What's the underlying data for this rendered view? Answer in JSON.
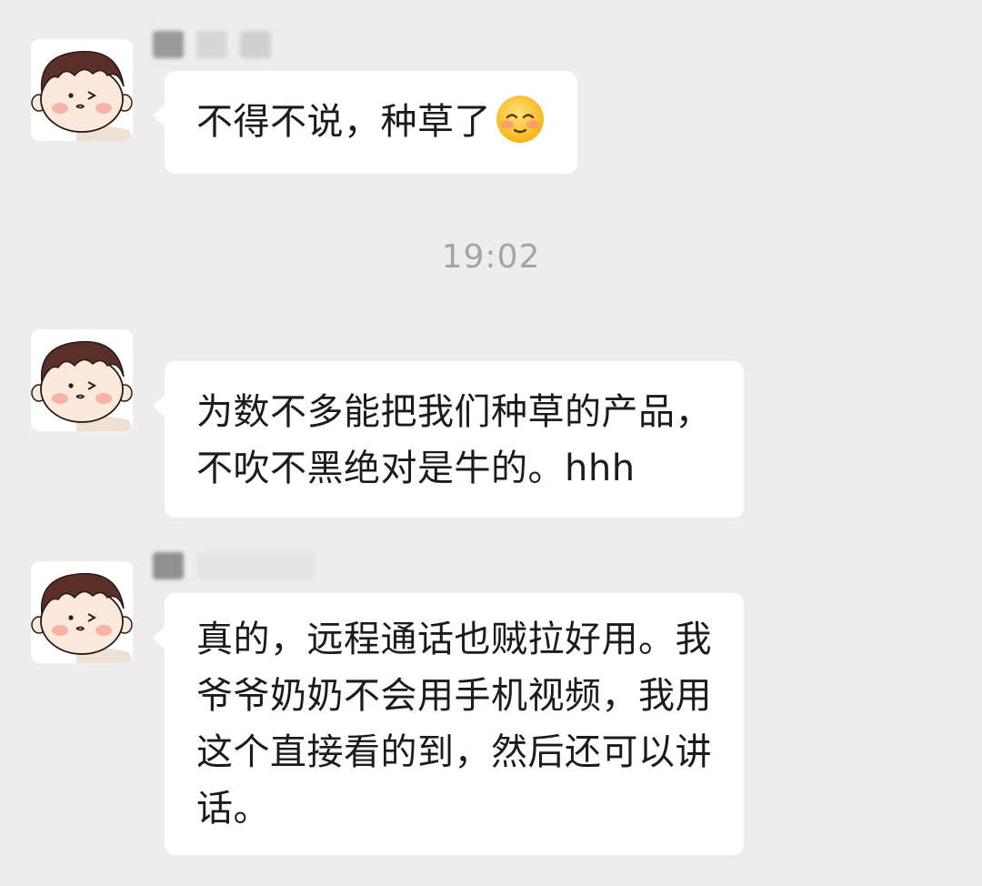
{
  "conversation": {
    "timestamp": "19:02",
    "messages": [
      {
        "text": "不得不说，种草了",
        "emoji": "pleading-smiling-face-emoji"
      },
      {
        "lines": [
          "为数不多能把我们种草的产品，",
          "不吹不黑绝对是牛的。hhh"
        ]
      },
      {
        "lines": [
          "真的，远程通话也贼拉好用。我",
          "爷爷奶奶不会用手机视频，我用",
          "这个直接看的到，然后还可以讲",
          "话。"
        ]
      }
    ]
  },
  "colors": {
    "background": "#ededed",
    "bubble": "#ffffff",
    "text": "#1b1b1b",
    "timestamp": "#a4a4a4"
  }
}
